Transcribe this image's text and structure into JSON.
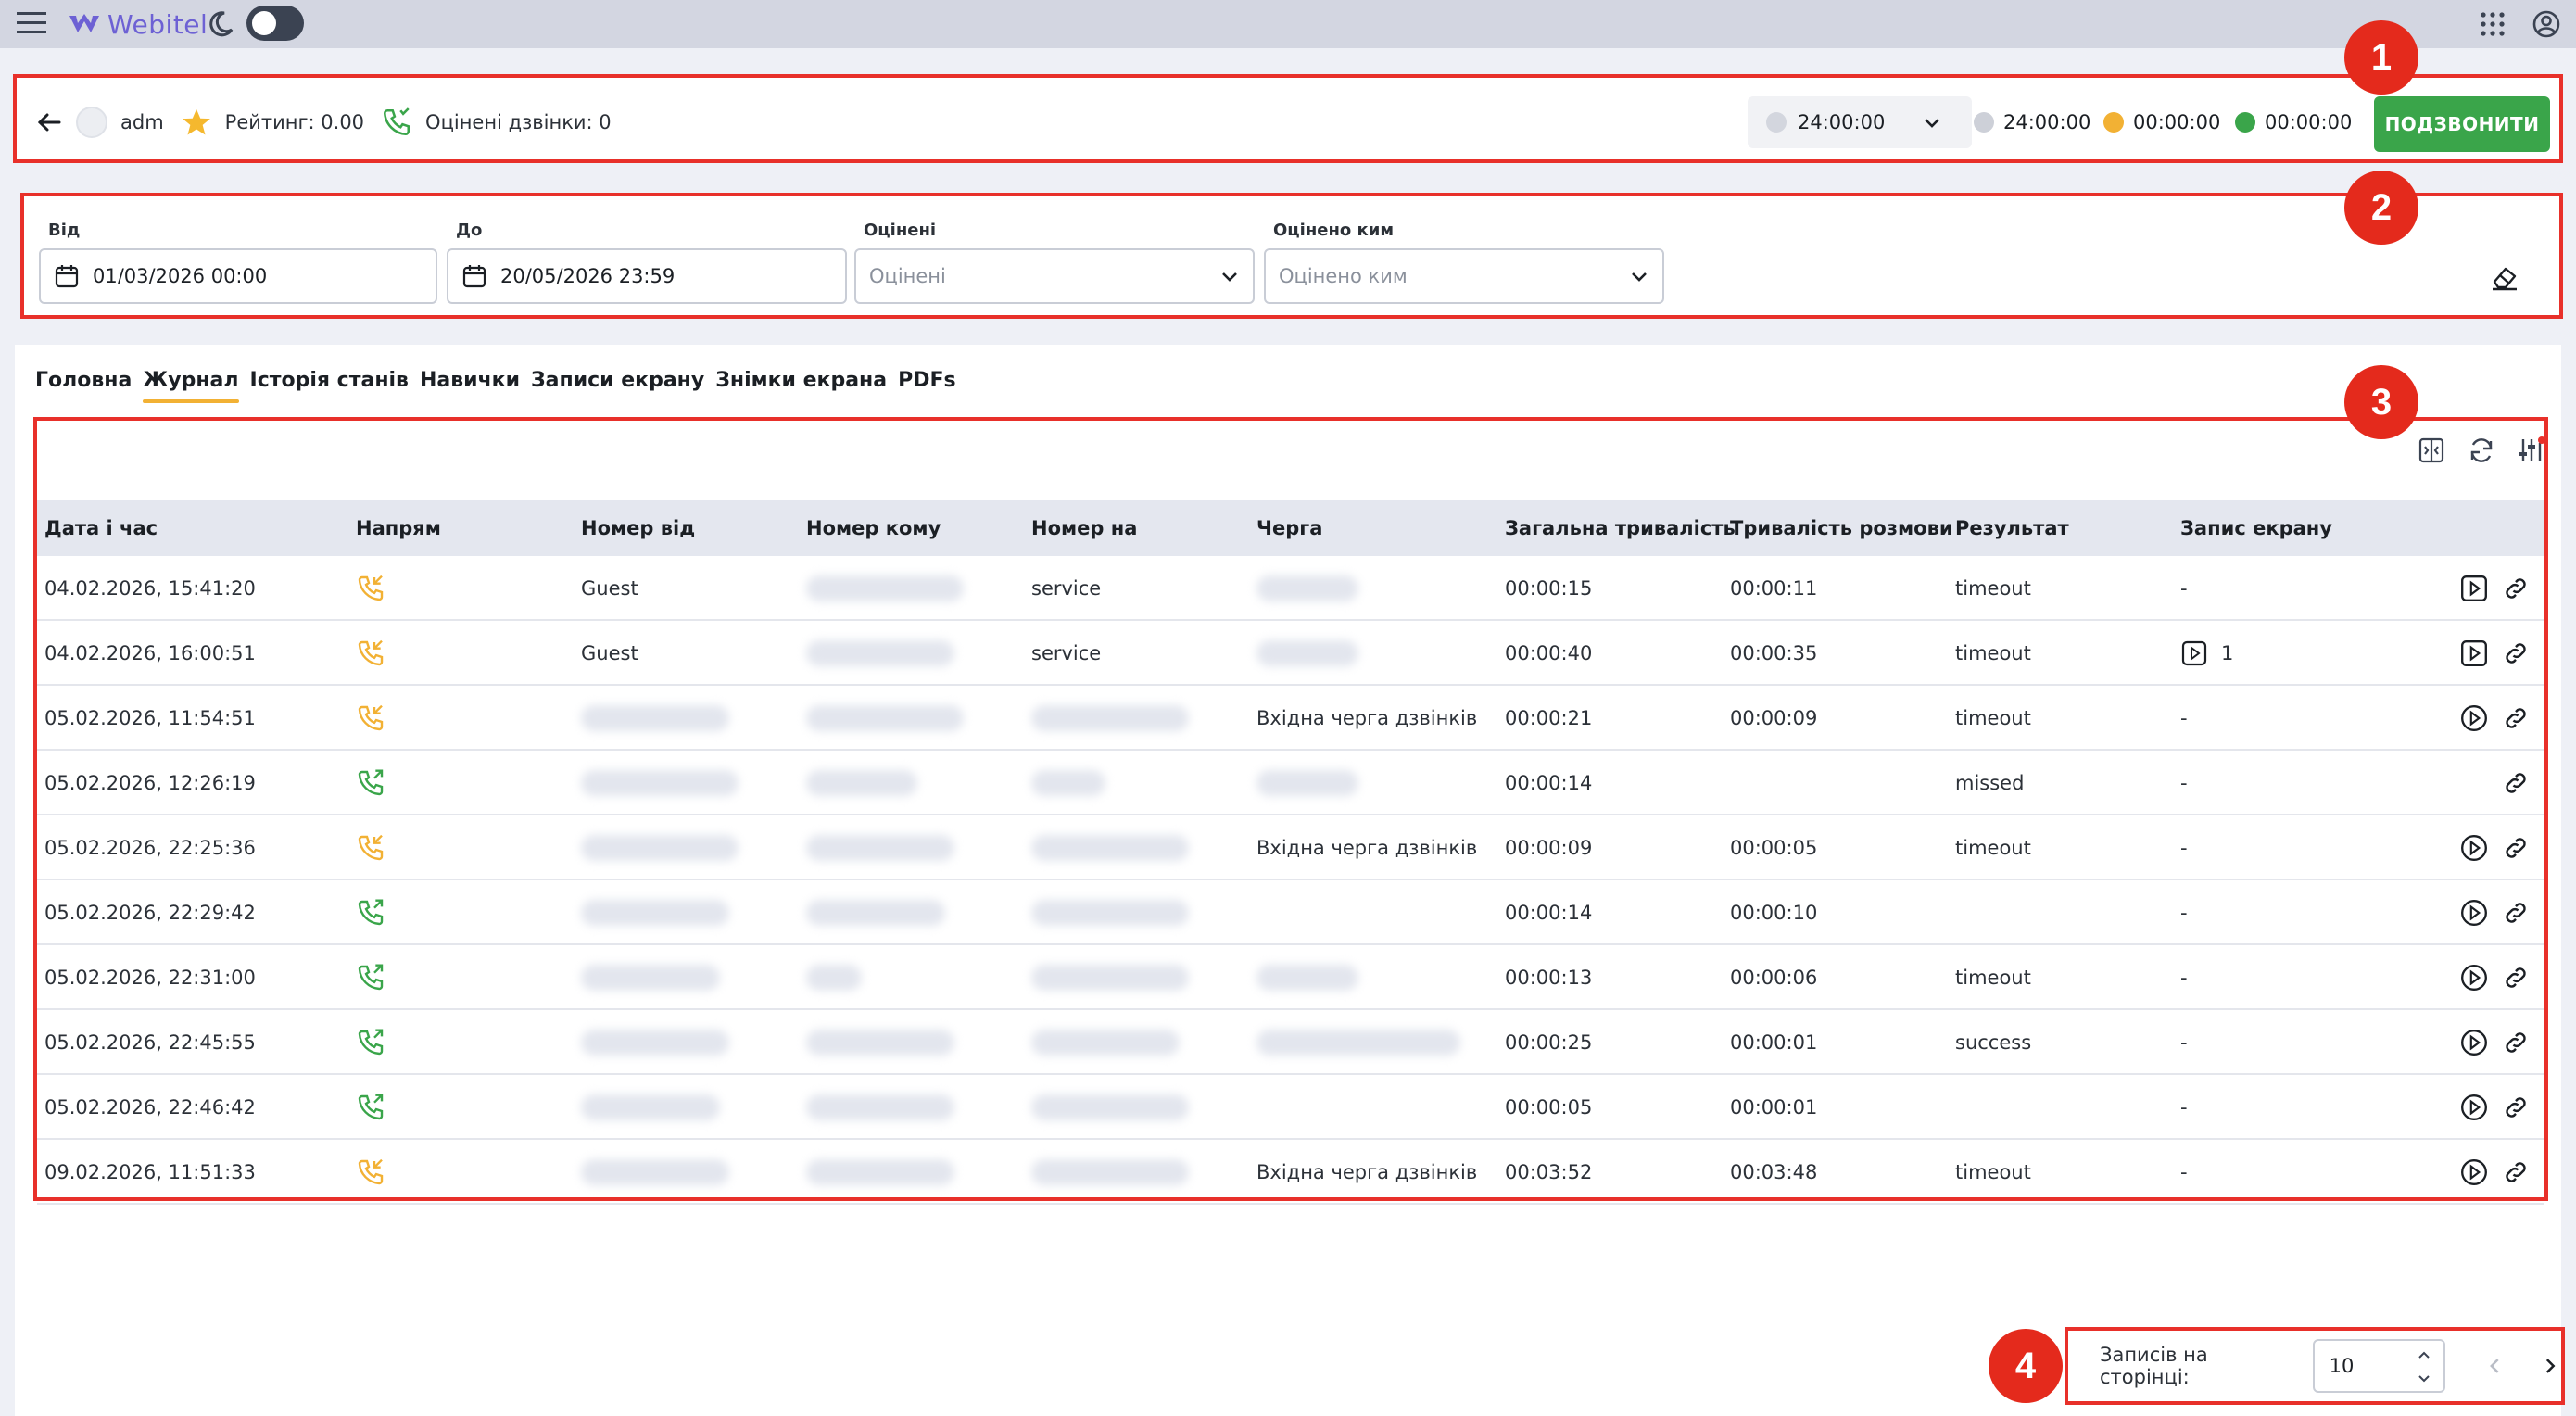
{
  "topbar": {
    "logo_text": "Webitel"
  },
  "agent": {
    "username": "adm",
    "rating_label": "Рейтинг: 0.00",
    "rated_calls_label": "Оцінені дзвінки: 0",
    "status_select_value": "24:00:00",
    "stat_grey": "24:00:00",
    "stat_yellow": "00:00:00",
    "stat_green": "00:00:00",
    "call_button_label": "ПОДЗВОНИТИ"
  },
  "filters": {
    "from_label": "Від",
    "from_value": "01/03/2026 00:00",
    "to_label": "До",
    "to_value": "20/05/2026 23:59",
    "rated_label": "Оцінені",
    "rated_placeholder": "Оцінені",
    "rated_by_label": "Оцінено ким",
    "rated_by_placeholder": "Оцінено ким"
  },
  "tabs": [
    "Головна",
    "Журнал",
    "Історія станів",
    "Навички",
    "Записи екрану",
    "Знімки екрана",
    "PDFs"
  ],
  "active_tab": 1,
  "table": {
    "headers": [
      "Дата і час",
      "Напрям",
      "Номер від",
      "Номер кому",
      "Номер на",
      "Черга",
      "Загальна тривалість",
      "Тривалість розмови",
      "Результат",
      "Запис екрану"
    ],
    "rows": [
      {
        "datetime": "04.02.2026, 15:41:20",
        "direction": "inbound",
        "from": "Guest",
        "to": "",
        "on": "service",
        "queue": "",
        "total": "00:00:15",
        "talk": "00:00:11",
        "result": "timeout",
        "screen": "-",
        "action": "video"
      },
      {
        "datetime": "04.02.2026, 16:00:51",
        "direction": "inbound",
        "from": "Guest",
        "to": "",
        "on": "service",
        "queue": "",
        "total": "00:00:40",
        "talk": "00:00:35",
        "result": "timeout",
        "screen": "1",
        "action": "video"
      },
      {
        "datetime": "05.02.2026, 11:54:51",
        "direction": "inbound",
        "from": "",
        "to": "",
        "on": "",
        "queue": "Вхідна черга дзвінків",
        "total": "00:00:21",
        "talk": "00:00:09",
        "result": "timeout",
        "screen": "-",
        "action": "play"
      },
      {
        "datetime": "05.02.2026, 12:26:19",
        "direction": "outbound",
        "from": "",
        "to": "",
        "on": "",
        "queue": "",
        "total": "00:00:14",
        "talk": "",
        "result": "missed",
        "screen": "-",
        "action": "none"
      },
      {
        "datetime": "05.02.2026, 22:25:36",
        "direction": "inbound",
        "from": "",
        "to": "",
        "on": "",
        "queue": "Вхідна черга дзвінків",
        "total": "00:00:09",
        "talk": "00:00:05",
        "result": "timeout",
        "screen": "-",
        "action": "play"
      },
      {
        "datetime": "05.02.2026, 22:29:42",
        "direction": "outbound",
        "from": "",
        "to": "",
        "on": "",
        "queue": "",
        "total": "00:00:14",
        "talk": "00:00:10",
        "result": "",
        "screen": "-",
        "action": "play"
      },
      {
        "datetime": "05.02.2026, 22:31:00",
        "direction": "outbound",
        "from": "",
        "to": "",
        "on": "",
        "queue": "",
        "total": "00:00:13",
        "talk": "00:00:06",
        "result": "timeout",
        "screen": "-",
        "action": "play"
      },
      {
        "datetime": "05.02.2026, 22:45:55",
        "direction": "outbound",
        "from": "",
        "to": "",
        "on": "",
        "queue": "",
        "total": "00:00:25",
        "talk": "00:00:01",
        "result": "success",
        "screen": "-",
        "action": "play"
      },
      {
        "datetime": "05.02.2026, 22:46:42",
        "direction": "outbound",
        "from": "",
        "to": "",
        "on": "",
        "queue": "",
        "total": "00:00:05",
        "talk": "00:00:01",
        "result": "",
        "screen": "-",
        "action": "play"
      },
      {
        "datetime": "09.02.2026, 11:51:33",
        "direction": "inbound",
        "from": "",
        "to": "",
        "on": "",
        "queue": "Вхідна черга дзвінків",
        "total": "00:03:52",
        "talk": "00:03:48",
        "result": "timeout",
        "screen": "-",
        "action": "play"
      }
    ]
  },
  "pagination": {
    "per_page_label": "Записів на сторінці:",
    "per_page_value": "10"
  },
  "annotations": [
    "1",
    "2",
    "3",
    "4"
  ],
  "colors": {
    "accent_red": "#e8302a",
    "call_green": "#3aa54a",
    "tab_underline": "#f2b134",
    "inbound_icon": "#f2b134",
    "outbound_icon": "#3aa54a"
  }
}
